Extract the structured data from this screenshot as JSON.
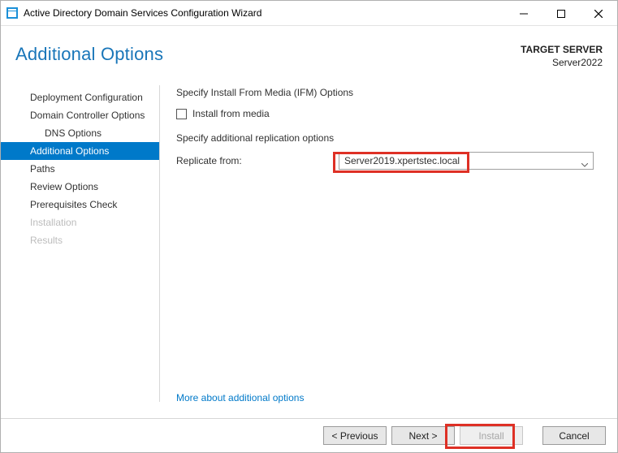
{
  "window": {
    "title": "Active Directory Domain Services Configuration Wizard"
  },
  "header": {
    "page_title": "Additional Options",
    "target_label": "TARGET SERVER",
    "target_value": "Server2022"
  },
  "sidebar": {
    "items": [
      {
        "label": "Deployment Configuration",
        "state": "normal"
      },
      {
        "label": "Domain Controller Options",
        "state": "normal"
      },
      {
        "label": "DNS Options",
        "state": "normal",
        "sub": true
      },
      {
        "label": "Additional Options",
        "state": "selected"
      },
      {
        "label": "Paths",
        "state": "normal"
      },
      {
        "label": "Review Options",
        "state": "normal"
      },
      {
        "label": "Prerequisites Check",
        "state": "normal"
      },
      {
        "label": "Installation",
        "state": "disabled"
      },
      {
        "label": "Results",
        "state": "disabled"
      }
    ]
  },
  "main": {
    "ifm_section_label": "Specify Install From Media (IFM) Options",
    "ifm_checkbox_label": "Install from media",
    "replication_section_label": "Specify additional replication options",
    "replicate_from_label": "Replicate from:",
    "replicate_from_value": "Server2019.xpertstec.local",
    "more_link": "More about additional options"
  },
  "footer": {
    "previous": "< Previous",
    "next": "Next >",
    "install": "Install",
    "cancel": "Cancel"
  }
}
